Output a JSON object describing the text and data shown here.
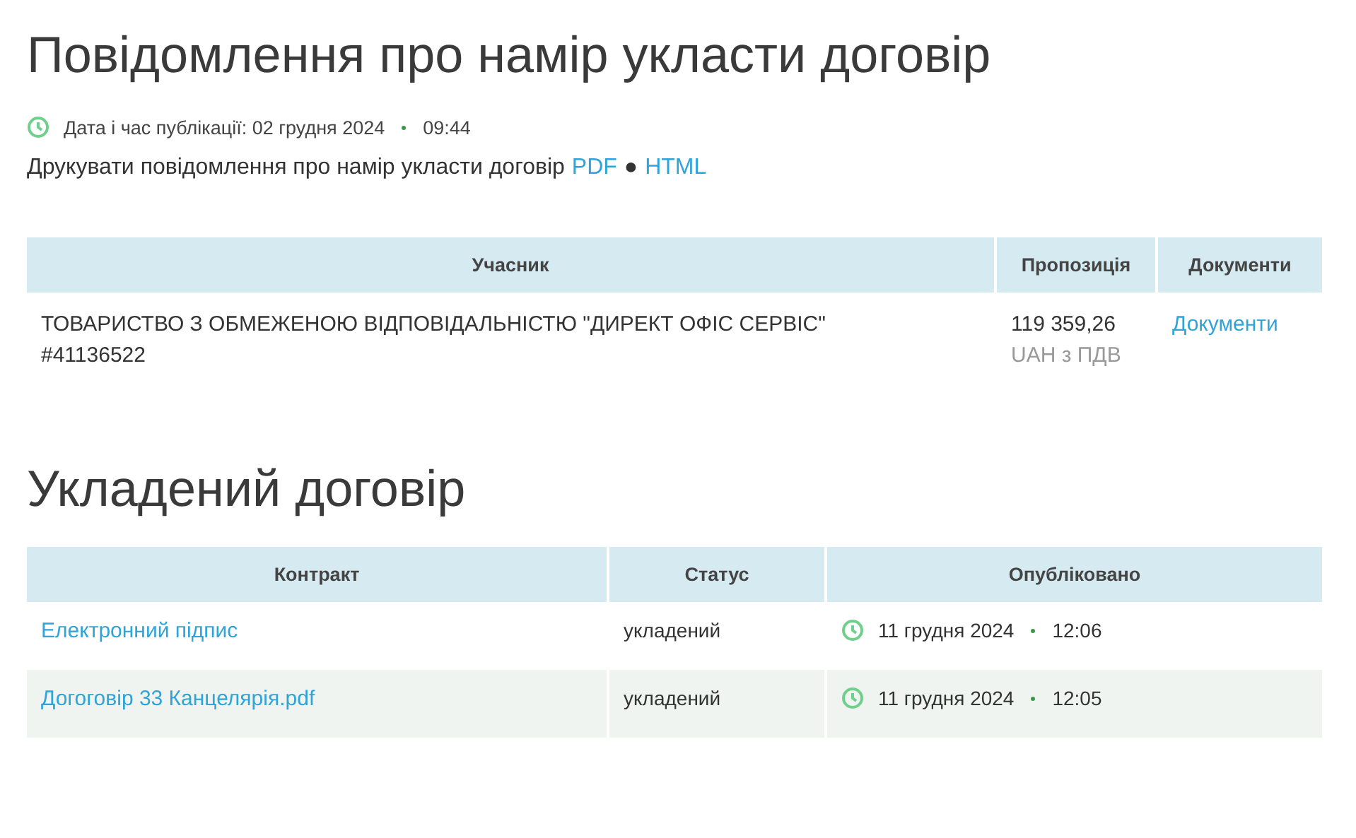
{
  "title": "Повідомлення про намір укласти договір",
  "publication": {
    "label": "Дата і час публікації: 02 грудня 2024",
    "time": "09:44"
  },
  "print": {
    "text": "Друкувати повідомлення про намір укласти договір",
    "links": [
      "PDF",
      "HTML"
    ],
    "separator": "●"
  },
  "bids_table": {
    "columns": [
      "Учасник",
      "Пропозиція",
      "Документи"
    ],
    "rows": [
      {
        "participant": "ТОВАРИСТВО З ОБМЕЖЕНОЮ ВІДПОВІДАЛЬНІСТЮ \"ДИРЕКТ ОФІС СЕРВІС\"",
        "code": "#41136522",
        "amount": "119 359,26",
        "currency": "UAH з ПДВ",
        "documents": "Документи"
      }
    ]
  },
  "contract_title": "Укладений договір",
  "contracts_table": {
    "columns": [
      "Контракт",
      "Статус",
      "Опубліковано"
    ],
    "rows": [
      {
        "contract": "Електронний підпис",
        "status": "укладений",
        "date": "11 грудня 2024",
        "time": "12:06"
      },
      {
        "contract": "Догоговір 33 Канцелярія.pdf",
        "status": "укладений",
        "date": "11 грудня 2024",
        "time": "12:05"
      }
    ]
  }
}
